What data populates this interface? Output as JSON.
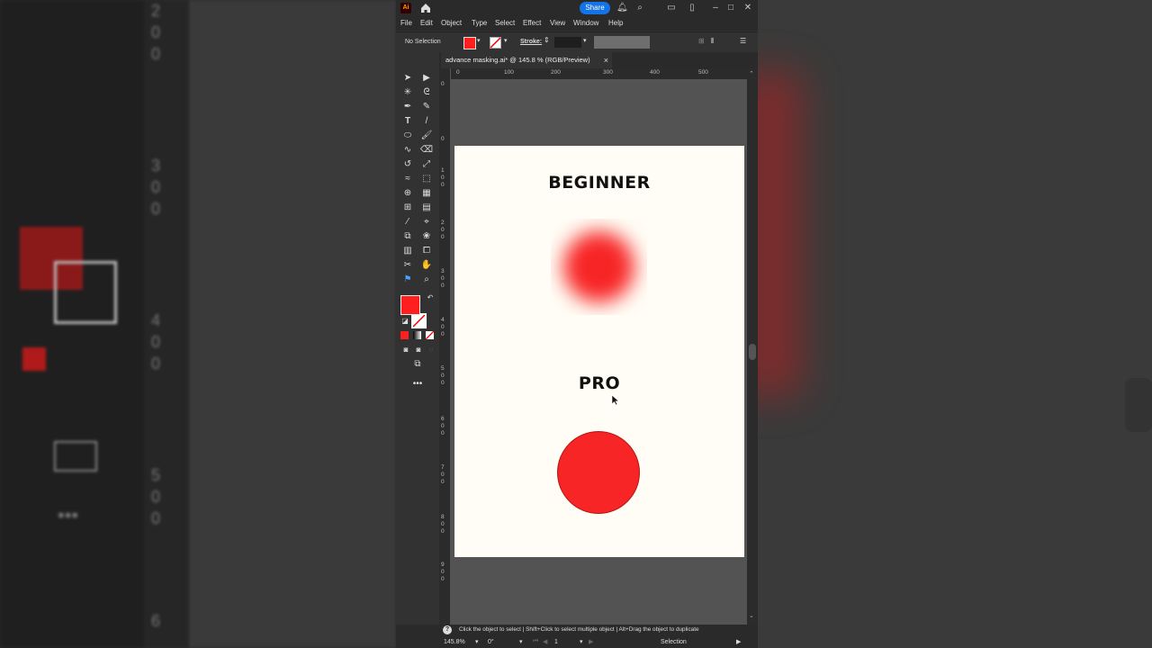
{
  "app": {
    "logo": "Ai",
    "share_label": "Share",
    "menu": [
      "File",
      "Edit",
      "Object",
      "Type",
      "Select",
      "Effect",
      "View",
      "Window",
      "Help"
    ]
  },
  "control_bar": {
    "selection_label": "No Selection",
    "stroke_label": "Stroke:",
    "fill_color": "#ff1f1f"
  },
  "document": {
    "tab_title": "advance masking.ai* @ 145.8 % (RGB/Preview)",
    "close_glyph": "×"
  },
  "rulers": {
    "h_labels": [
      "0",
      "100",
      "200",
      "300",
      "400",
      "500"
    ],
    "v_labels": [
      "0",
      "0",
      "1 0 0",
      "2 0 0",
      "3 0 0",
      "4 0 0",
      "5 0 0",
      "6 0 0",
      "7 0 0",
      "8 0 0",
      "9 0 0"
    ]
  },
  "artboard": {
    "heading_beginner": "BEGINNER",
    "heading_pro": "PRO",
    "circle_color": "#f72525",
    "background": "#fffdf5"
  },
  "status": {
    "help_text": "Click the object to select  |  Shift+Click to select multiple object  |  Alt+Drag the object to duplicate",
    "zoom": "145.8%",
    "rotation": "0°",
    "artboard_num": "1",
    "tool_name": "Selection"
  },
  "background_overlay": {
    "left_ruler_digits": [
      "2",
      "0",
      "0",
      "3",
      "0",
      "0",
      "4",
      "0",
      "0",
      "5",
      "0",
      "0",
      "6"
    ]
  }
}
